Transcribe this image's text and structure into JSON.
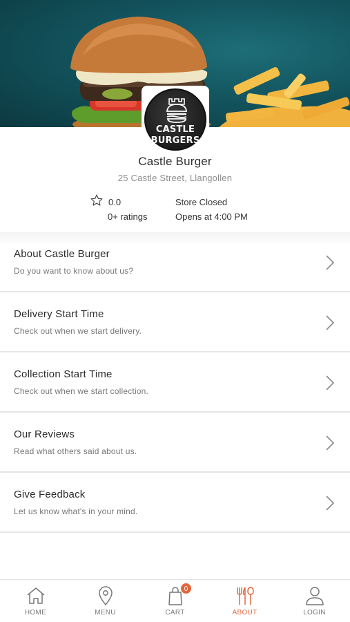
{
  "store": {
    "logo_line1": "CASTLE",
    "logo_line2": "BURGERS",
    "name": "Castle Burger",
    "address": "25 Castle Street, Llangollen",
    "rating_value": "0.0",
    "rating_count": "0+ ratings",
    "status": "Store Closed",
    "opens_at": "Opens at 4:00 PM"
  },
  "menu": [
    {
      "title": "About Castle Burger",
      "subtitle": "Do you want to know about us?"
    },
    {
      "title": "Delivery Start Time",
      "subtitle": "Check out when we start delivery."
    },
    {
      "title": "Collection Start Time",
      "subtitle": "Check out when we start collection."
    },
    {
      "title": "Our Reviews",
      "subtitle": "Read what others said about us."
    },
    {
      "title": "Give Feedback",
      "subtitle": "Let us know what's in your mind."
    }
  ],
  "nav": {
    "home": "HOME",
    "menu": "MENU",
    "cart": "CART",
    "cart_count": "0",
    "about": "ABOUT",
    "login": "LOGIN",
    "active": "about"
  },
  "colors": {
    "accent": "#e06a43",
    "hero_bg": "#13545e"
  },
  "icons": [
    "home-icon",
    "location-pin-icon",
    "shopping-bag-icon",
    "fork-knife-icon",
    "user-icon",
    "star-icon",
    "chevron-right-icon"
  ]
}
